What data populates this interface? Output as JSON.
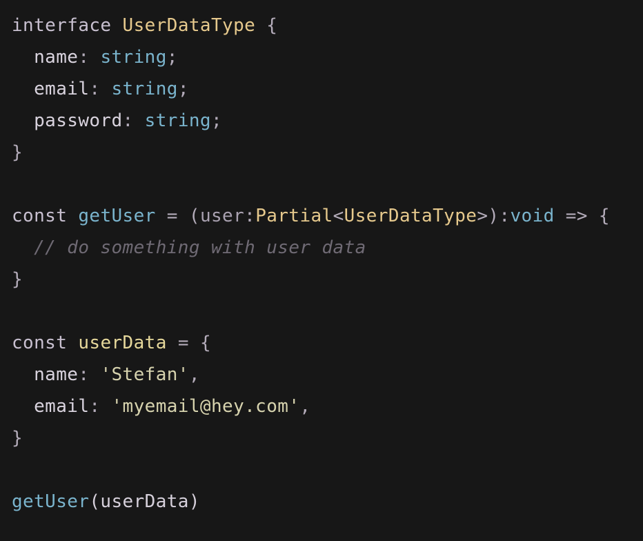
{
  "theme": {
    "background": "#171717",
    "keyword": "#c8c0d0",
    "type": "#e6c98d",
    "builtin": "#7ab4cd",
    "string": "#d7d3ae",
    "comment": "#6f6a74"
  },
  "code": {
    "lines": [
      [
        {
          "t": "interface",
          "k": "keyword"
        },
        {
          "t": " ",
          "k": "plain"
        },
        {
          "t": "UserDataType",
          "k": "type"
        },
        {
          "t": " {",
          "k": "punct"
        }
      ],
      [
        {
          "t": "  name",
          "k": "prop"
        },
        {
          "t": ": ",
          "k": "punct"
        },
        {
          "t": "string",
          "k": "builtin"
        },
        {
          "t": ";",
          "k": "punct"
        }
      ],
      [
        {
          "t": "  email",
          "k": "prop"
        },
        {
          "t": ": ",
          "k": "punct"
        },
        {
          "t": "string",
          "k": "builtin"
        },
        {
          "t": ";",
          "k": "punct"
        }
      ],
      [
        {
          "t": "  password",
          "k": "prop"
        },
        {
          "t": ": ",
          "k": "punct"
        },
        {
          "t": "string",
          "k": "builtin"
        },
        {
          "t": ";",
          "k": "punct"
        }
      ],
      [
        {
          "t": "}",
          "k": "punct"
        }
      ],
      [],
      [
        {
          "t": "const",
          "k": "keyword"
        },
        {
          "t": " ",
          "k": "plain"
        },
        {
          "t": "getUser",
          "k": "fn"
        },
        {
          "t": " = ",
          "k": "op"
        },
        {
          "t": "(",
          "k": "punct"
        },
        {
          "t": "user",
          "k": "param"
        },
        {
          "t": ":",
          "k": "punct"
        },
        {
          "t": "Partial",
          "k": "type"
        },
        {
          "t": "<",
          "k": "punct"
        },
        {
          "t": "UserDataType",
          "k": "type"
        },
        {
          "t": ">):",
          "k": "punct"
        },
        {
          "t": "void",
          "k": "builtin"
        },
        {
          "t": " => {",
          "k": "op"
        }
      ],
      [
        {
          "t": "  // do something with user data",
          "k": "comment"
        }
      ],
      [
        {
          "t": "}",
          "k": "punct"
        }
      ],
      [],
      [
        {
          "t": "const",
          "k": "keyword"
        },
        {
          "t": " ",
          "k": "plain"
        },
        {
          "t": "userData",
          "k": "var"
        },
        {
          "t": " = {",
          "k": "op"
        }
      ],
      [
        {
          "t": "  name",
          "k": "prop"
        },
        {
          "t": ": ",
          "k": "punct"
        },
        {
          "t": "'Stefan'",
          "k": "string"
        },
        {
          "t": ",",
          "k": "punct"
        }
      ],
      [
        {
          "t": "  email",
          "k": "prop"
        },
        {
          "t": ": ",
          "k": "punct"
        },
        {
          "t": "'myemail@hey.com'",
          "k": "string"
        },
        {
          "t": ",",
          "k": "punct"
        }
      ],
      [
        {
          "t": "}",
          "k": "punct"
        }
      ],
      [],
      [
        {
          "t": "getUser",
          "k": "fn"
        },
        {
          "t": "(userData)",
          "k": "plain"
        }
      ]
    ]
  }
}
